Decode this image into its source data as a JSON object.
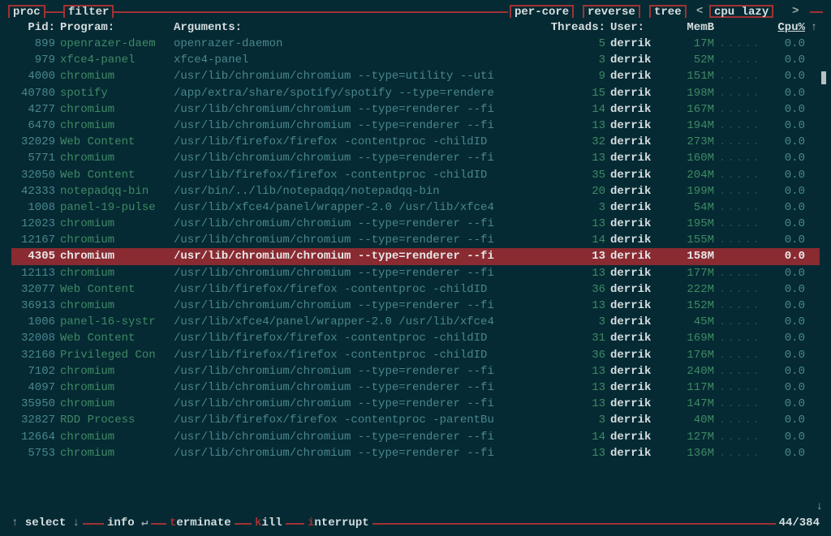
{
  "top": {
    "proc": "proc",
    "filter": "filter",
    "perCore": "per-core",
    "reverse": "reverse",
    "tree": "tree",
    "cpu": "cpu",
    "lazy": "lazy",
    "lcar": "<",
    "rcar": ">"
  },
  "head": {
    "pid": "Pid:",
    "program": "Program:",
    "arguments": "Arguments:",
    "threads": "Threads:",
    "user": "User:",
    "mem": "MemB",
    "cpu": "Cpu%",
    "arrow": "↑"
  },
  "dots": ".....",
  "rows": [
    {
      "pid": "899",
      "prog": "openrazer-daem",
      "args": "openrazer-daemon",
      "thr": "5",
      "user": "derrik",
      "mem": "17M",
      "cpu": "0.0",
      "sel": false
    },
    {
      "pid": "979",
      "prog": "xfce4-panel",
      "args": "xfce4-panel",
      "thr": "3",
      "user": "derrik",
      "mem": "52M",
      "cpu": "0.0",
      "sel": false
    },
    {
      "pid": "4000",
      "prog": "chromium",
      "args": "/usr/lib/chromium/chromium --type=utility --uti",
      "thr": "9",
      "user": "derrik",
      "mem": "151M",
      "cpu": "0.0",
      "sel": false
    },
    {
      "pid": "40780",
      "prog": "spotify",
      "args": "/app/extra/share/spotify/spotify --type=rendere",
      "thr": "15",
      "user": "derrik",
      "mem": "198M",
      "cpu": "0.0",
      "sel": false
    },
    {
      "pid": "4277",
      "prog": "chromium",
      "args": "/usr/lib/chromium/chromium --type=renderer --fi",
      "thr": "14",
      "user": "derrik",
      "mem": "167M",
      "cpu": "0.0",
      "sel": false
    },
    {
      "pid": "6470",
      "prog": "chromium",
      "args": "/usr/lib/chromium/chromium --type=renderer --fi",
      "thr": "13",
      "user": "derrik",
      "mem": "194M",
      "cpu": "0.0",
      "sel": false
    },
    {
      "pid": "32029",
      "prog": "Web Content",
      "args": "/usr/lib/firefox/firefox -contentproc -childID",
      "thr": "32",
      "user": "derrik",
      "mem": "273M",
      "cpu": "0.0",
      "sel": false
    },
    {
      "pid": "5771",
      "prog": "chromium",
      "args": "/usr/lib/chromium/chromium --type=renderer --fi",
      "thr": "13",
      "user": "derrik",
      "mem": "160M",
      "cpu": "0.0",
      "sel": false
    },
    {
      "pid": "32050",
      "prog": "Web Content",
      "args": "/usr/lib/firefox/firefox -contentproc -childID",
      "thr": "35",
      "user": "derrik",
      "mem": "204M",
      "cpu": "0.0",
      "sel": false
    },
    {
      "pid": "42333",
      "prog": "notepadqq-bin",
      "args": "/usr/bin/../lib/notepadqq/notepadqq-bin",
      "thr": "20",
      "user": "derrik",
      "mem": "199M",
      "cpu": "0.0",
      "sel": false
    },
    {
      "pid": "1008",
      "prog": "panel-19-pulse",
      "args": "/usr/lib/xfce4/panel/wrapper-2.0 /usr/lib/xfce4",
      "thr": "3",
      "user": "derrik",
      "mem": "54M",
      "cpu": "0.0",
      "sel": false
    },
    {
      "pid": "12023",
      "prog": "chromium",
      "args": "/usr/lib/chromium/chromium --type=renderer --fi",
      "thr": "13",
      "user": "derrik",
      "mem": "195M",
      "cpu": "0.0",
      "sel": false
    },
    {
      "pid": "12167",
      "prog": "chromium",
      "args": "/usr/lib/chromium/chromium --type=renderer --fi",
      "thr": "14",
      "user": "derrik",
      "mem": "155M",
      "cpu": "0.0",
      "sel": false
    },
    {
      "pid": "4305",
      "prog": "chromium",
      "args": "/usr/lib/chromium/chromium --type=renderer --fi",
      "thr": "13",
      "user": "derrik",
      "mem": "158M",
      "cpu": "0.0",
      "sel": true
    },
    {
      "pid": "12113",
      "prog": "chromium",
      "args": "/usr/lib/chromium/chromium --type=renderer --fi",
      "thr": "13",
      "user": "derrik",
      "mem": "177M",
      "cpu": "0.0",
      "sel": false
    },
    {
      "pid": "32077",
      "prog": "Web Content",
      "args": "/usr/lib/firefox/firefox -contentproc -childID",
      "thr": "36",
      "user": "derrik",
      "mem": "222M",
      "cpu": "0.0",
      "sel": false
    },
    {
      "pid": "36913",
      "prog": "chromium",
      "args": "/usr/lib/chromium/chromium --type=renderer --fi",
      "thr": "13",
      "user": "derrik",
      "mem": "152M",
      "cpu": "0.0",
      "sel": false
    },
    {
      "pid": "1006",
      "prog": "panel-16-systr",
      "args": "/usr/lib/xfce4/panel/wrapper-2.0 /usr/lib/xfce4",
      "thr": "3",
      "user": "derrik",
      "mem": "45M",
      "cpu": "0.0",
      "sel": false
    },
    {
      "pid": "32008",
      "prog": "Web Content",
      "args": "/usr/lib/firefox/firefox -contentproc -childID",
      "thr": "31",
      "user": "derrik",
      "mem": "169M",
      "cpu": "0.0",
      "sel": false
    },
    {
      "pid": "32160",
      "prog": "Privileged Con",
      "args": "/usr/lib/firefox/firefox -contentproc -childID",
      "thr": "36",
      "user": "derrik",
      "mem": "176M",
      "cpu": "0.0",
      "sel": false
    },
    {
      "pid": "7102",
      "prog": "chromium",
      "args": "/usr/lib/chromium/chromium --type=renderer --fi",
      "thr": "13",
      "user": "derrik",
      "mem": "240M",
      "cpu": "0.0",
      "sel": false
    },
    {
      "pid": "4097",
      "prog": "chromium",
      "args": "/usr/lib/chromium/chromium --type=renderer --fi",
      "thr": "13",
      "user": "derrik",
      "mem": "117M",
      "cpu": "0.0",
      "sel": false
    },
    {
      "pid": "35950",
      "prog": "chromium",
      "args": "/usr/lib/chromium/chromium --type=renderer --fi",
      "thr": "13",
      "user": "derrik",
      "mem": "147M",
      "cpu": "0.0",
      "sel": false
    },
    {
      "pid": "32827",
      "prog": "RDD Process",
      "args": "/usr/lib/firefox/firefox -contentproc -parentBu",
      "thr": "3",
      "user": "derrik",
      "mem": "40M",
      "cpu": "0.0",
      "sel": false
    },
    {
      "pid": "12664",
      "prog": "chromium",
      "args": "/usr/lib/chromium/chromium --type=renderer --fi",
      "thr": "14",
      "user": "derrik",
      "mem": "127M",
      "cpu": "0.0",
      "sel": false
    },
    {
      "pid": "5753",
      "prog": "chromium",
      "args": "/usr/lib/chromium/chromium --type=renderer --fi",
      "thr": "13",
      "user": "derrik",
      "mem": "136M",
      "cpu": "0.0",
      "sel": false
    }
  ],
  "bottom": {
    "select": "select",
    "info": "info",
    "terminate": "erminate",
    "tKey": "t",
    "kill": "ill",
    "kKey": "k",
    "interrupt": "nterrupt",
    "iKey": "i",
    "up": "↑",
    "down": "↓",
    "enter": "↵",
    "downArrow": "↓",
    "count": "44/384"
  }
}
